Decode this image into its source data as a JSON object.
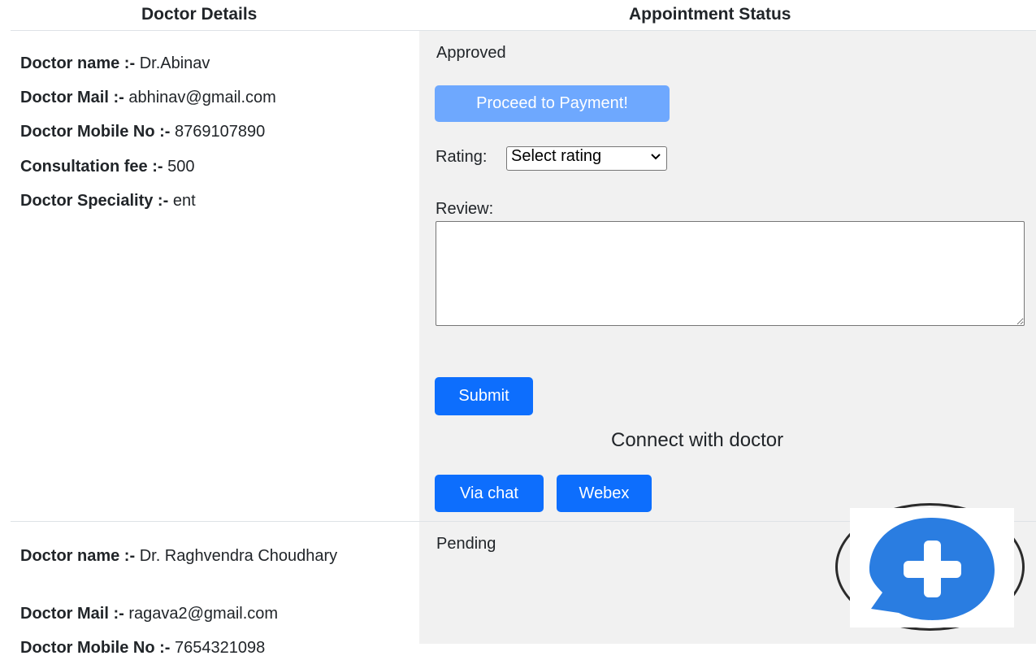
{
  "headers": {
    "doctor_details": "Doctor Details",
    "appointment_status": "Appointment Status"
  },
  "appointments": [
    {
      "doctor": {
        "name_label": "Doctor name :-",
        "name": "Dr.Abinav",
        "mail_label": "Doctor Mail :-",
        "mail": "abhinav@gmail.com",
        "mobile_label": "Doctor Mobile No :-",
        "mobile": "8769107890",
        "fee_label": "Consultation fee :-",
        "fee": "500",
        "speciality_label": "Doctor Speciality :-",
        "speciality": "ent"
      },
      "status": "Approved",
      "payment_button": "Proceed to Payment!",
      "rating_label": "Rating:",
      "rating_selected": "Select rating",
      "review_label": "Review:",
      "review_value": "",
      "submit_button": "Submit",
      "connect_title": "Connect with doctor",
      "chat_button": "Via chat",
      "webex_button": "Webex"
    },
    {
      "doctor": {
        "name_label": "Doctor name :-",
        "name": "Dr. Raghvendra Choudhary",
        "mail_label": "Doctor Mail :-",
        "mail": "ragava2@gmail.com",
        "mobile_label": "Doctor Mobile No :-",
        "mobile": "7654321098"
      },
      "status": "Pending"
    }
  ],
  "chat_widget": {
    "icon": "chat-plus-icon",
    "color": "#2a7de1"
  },
  "colors": {
    "primary": "#0d6efd",
    "primary_disabled": "#6ea8fe",
    "status_bg": "#f1f1f1"
  }
}
